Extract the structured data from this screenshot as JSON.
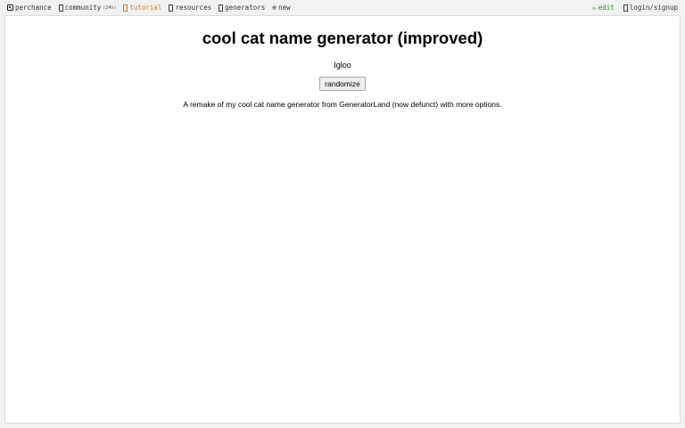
{
  "topbar": {
    "left": [
      {
        "id": "perchance",
        "label": "perchance",
        "icon": "dice-icon"
      },
      {
        "id": "community",
        "label": "community",
        "badge": "(24h)",
        "icon": "box-icon"
      },
      {
        "id": "tutorial",
        "label": "tutorial",
        "icon": "box-icon",
        "color": "#d97a1a"
      },
      {
        "id": "resources",
        "label": "resources",
        "icon": "box-icon"
      },
      {
        "id": "generators",
        "label": "generators",
        "icon": "box-icon"
      },
      {
        "id": "new",
        "label": "new",
        "icon": "plus-circle-icon"
      }
    ],
    "right": [
      {
        "id": "edit",
        "label": "edit",
        "icon": "pencil-icon",
        "color": "#2f8f2f"
      },
      {
        "id": "login",
        "label": "login/signup",
        "icon": "box-icon"
      }
    ]
  },
  "main": {
    "title": "cool cat name generator (improved)",
    "output": "Igloo",
    "randomize_label": "randomize",
    "description": "A remake of my cool cat name generator from GeneratorLand (now defunct) with more options."
  }
}
